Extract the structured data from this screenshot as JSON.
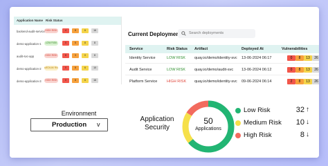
{
  "mini_table": {
    "headers": [
      "Application Name",
      "Risk Status"
    ],
    "rows": [
      {
        "app": "backend-audit-service",
        "status": "HIGH RISK",
        "status_color": "#f9d3cf",
        "status_text": "#d6453a",
        "vuls": [
          "4",
          "8",
          "6",
          "16"
        ]
      },
      {
        "app": "demo-application-1",
        "status": "LOW RISK",
        "status_color": "#d8f1d0",
        "status_text": "#3c8a2e",
        "vuls": [
          "0",
          "5",
          "8",
          "8"
        ]
      },
      {
        "app": "audit-svc-app",
        "status": "HIGH RISK",
        "status_color": "#f9d3cf",
        "status_text": "#d6453a",
        "vuls": [
          "8",
          "3",
          "0",
          "8"
        ]
      },
      {
        "app": "demo-application-2",
        "status": "MEDIUM RISK",
        "status_color": "#fbeec4",
        "status_text": "#b8860b",
        "vuls": [
          "0",
          "8",
          "6",
          "10"
        ]
      },
      {
        "app": "demo-application-3",
        "status": "HIGH RISK",
        "status_color": "#f9d3cf",
        "status_text": "#d6453a",
        "vuls": [
          "0",
          "8",
          "6",
          "16"
        ]
      }
    ]
  },
  "deployments": {
    "title": "Current Deployments",
    "search_placeholder": "Search deployments",
    "columns": [
      "Service",
      "Risk Status",
      "Artifact",
      "Deployed At",
      "Vulnerabilities"
    ],
    "rows": [
      {
        "service": "Identity Service",
        "risk": "LOW RISK",
        "risk_color": "#2f8f2f",
        "artifact": "quay.io/demo/identity-svc",
        "deployed": "13-06-2024 06:17",
        "vuls": [
          "0",
          "8",
          "13",
          "26"
        ]
      },
      {
        "service": "Audit Service",
        "risk": "LOW RISK",
        "risk_color": "#2f8f2f",
        "artifact": "quay.io/demo/audit-svc",
        "deployed": "13-06-2024 06:12",
        "vuls": [
          "0",
          "8",
          "13",
          "26"
        ]
      },
      {
        "service": "Platform Service",
        "risk": "HIGH RISK",
        "risk_color": "#e0463b",
        "artifact": "quay.io/demo/identity-svc",
        "deployed": "09-06-2024 06:14",
        "vuls": [
          "2",
          "8",
          "13",
          "26"
        ]
      }
    ],
    "vul_colors": [
      "#f2564a",
      "#f7a13c",
      "#f5d44a",
      "#d9d9d9"
    ]
  },
  "environment": {
    "label": "Environment",
    "selected": "Production",
    "chevron": "v"
  },
  "security": {
    "title_line1": "Application",
    "title_line2": "Security",
    "total": "50",
    "total_label": "Applications",
    "segments": [
      {
        "name": "Low Risk",
        "count": "32",
        "trend": "↑",
        "color": "#22b573",
        "value": 32
      },
      {
        "name": "Medium Risk",
        "count": "10",
        "trend": "↓",
        "color": "#f6e04a",
        "value": 10
      },
      {
        "name": "High Risk",
        "count": "8",
        "trend": "↓",
        "color": "#f26b5e",
        "value": 8
      }
    ]
  }
}
